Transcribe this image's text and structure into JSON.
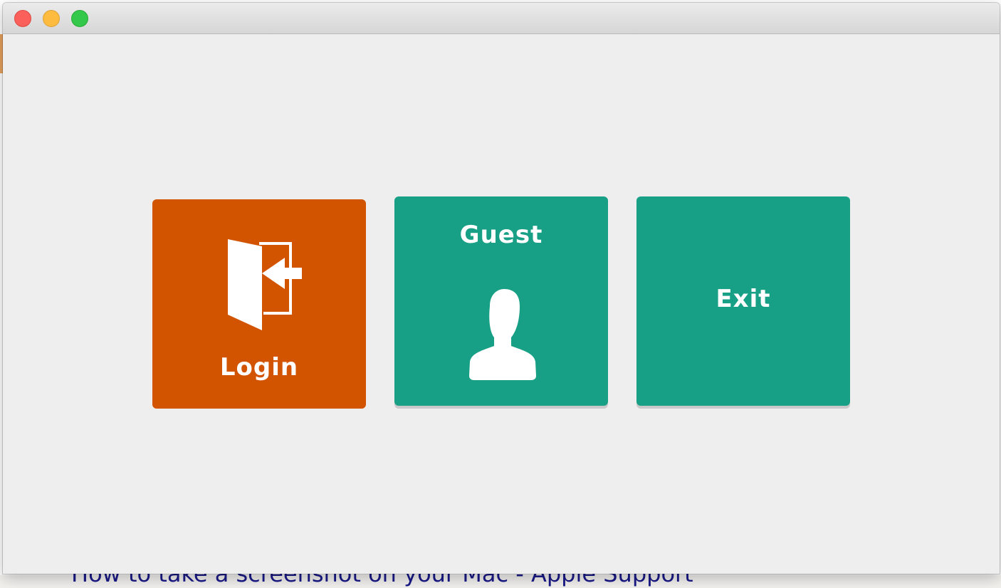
{
  "window": {
    "controls": [
      "close",
      "minimize",
      "maximize"
    ]
  },
  "background": {
    "partial_text": "How to take a screenshot on your Mac - Apple Support"
  },
  "tiles": {
    "login": {
      "label": "Login",
      "icon": "login-door-icon",
      "color": "#d35400"
    },
    "guest": {
      "label": "Guest",
      "icon": "user-silhouette-icon",
      "color": "#17a085"
    },
    "exit": {
      "label": "Exit",
      "color": "#17a085"
    }
  }
}
